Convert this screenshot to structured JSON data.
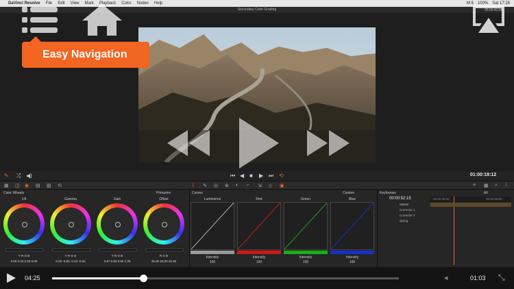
{
  "menubar": {
    "apple": "",
    "app_name": "DaVinci Resolve",
    "items": [
      "File",
      "Edit",
      "View",
      "Mark",
      "Playback",
      "Color",
      "Nodes",
      "Help"
    ],
    "status": [
      "M 6",
      "100%",
      "Sat 17:28"
    ]
  },
  "window": {
    "title": "Secondary Color Grading"
  },
  "viewer": {
    "timecode_top": "00:00:42:00",
    "timecode": "01:00:19:12"
  },
  "overlay": {
    "badge": "Easy Navigation"
  },
  "color_wheels": {
    "title": "Color Wheels",
    "mode": "Primaries",
    "wheels": [
      {
        "label": "Lift",
        "channels": "Y  R  G  B",
        "values": "0.00  0.00  0.00  0.00"
      },
      {
        "label": "Gamma",
        "channels": "Y  R  G  B",
        "values": "0.00  -0.05  -0.03  -0.02"
      },
      {
        "label": "Gain",
        "channels": "Y  R  G  B",
        "values": "0.87  0.86  0.90  1.05"
      },
      {
        "label": "Offset",
        "channels": "R  G  B",
        "values": "25.00  25.00  25.00"
      }
    ]
  },
  "curves": {
    "title": "Curves",
    "mode": "Custom",
    "channels": [
      {
        "label": "Luminance",
        "intensity_label": "Intensity",
        "intensity": "100",
        "color": "#9a9a9a"
      },
      {
        "label": "Red",
        "intensity_label": "Intensity",
        "intensity": "100",
        "color": "#d01818"
      },
      {
        "label": "Green",
        "intensity_label": "Intensity",
        "intensity": "100",
        "color": "#18b018"
      },
      {
        "label": "Blue",
        "intensity_label": "Intensity",
        "intensity": "100",
        "color": "#1830d0"
      }
    ]
  },
  "keyframes": {
    "title": "Keyframes",
    "filter": "All",
    "timecode": "00:00:52:15",
    "ruler": [
      "00:00:49:16",
      "00:00:55:05"
    ],
    "tracks": [
      "Master",
      "Corrector 1",
      "Corrector 2",
      "Sizing"
    ]
  },
  "player": {
    "current_time": "04:25",
    "end_time": "01:03",
    "progress": 0.262
  }
}
